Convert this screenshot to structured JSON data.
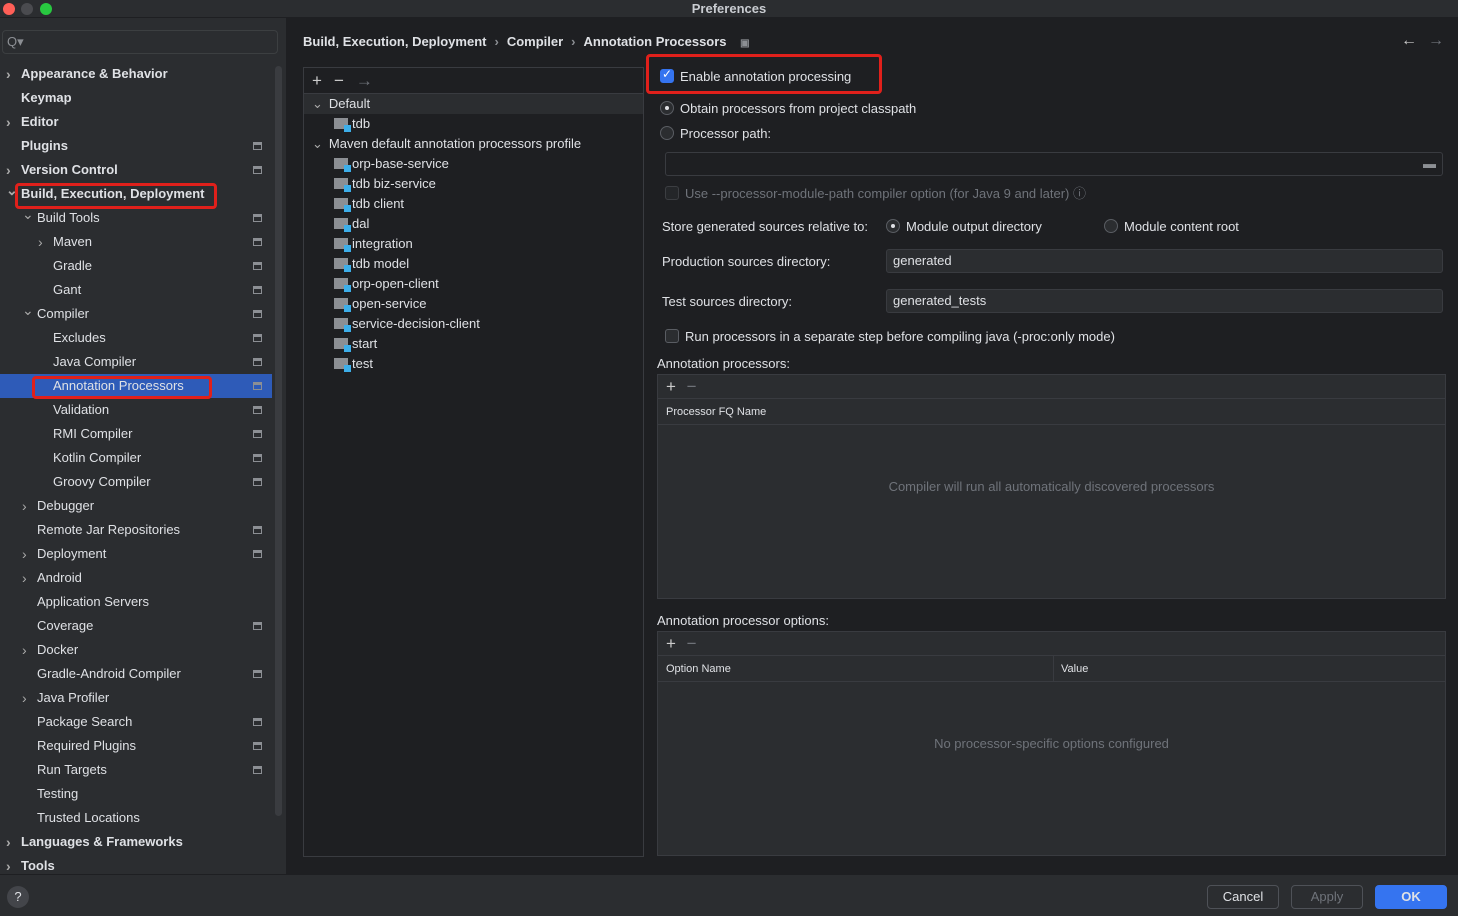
{
  "window": {
    "title": "Preferences"
  },
  "search": {
    "placeholder": "Q▾"
  },
  "sidebar": {
    "items": [
      {
        "label": "Appearance & Behavior",
        "level": 0,
        "chevron": "right",
        "bold": true,
        "settings": false
      },
      {
        "label": "Keymap",
        "level": 0,
        "chevron": "",
        "bold": true,
        "settings": false
      },
      {
        "label": "Editor",
        "level": 0,
        "chevron": "right",
        "bold": true,
        "settings": false
      },
      {
        "label": "Plugins",
        "level": 0,
        "chevron": "",
        "bold": true,
        "settings": true
      },
      {
        "label": "Version Control",
        "level": 0,
        "chevron": "right",
        "bold": true,
        "settings": true
      },
      {
        "label": "Build, Execution, Deployment",
        "level": 0,
        "chevron": "down",
        "bold": true,
        "settings": false
      },
      {
        "label": "Build Tools",
        "level": 1,
        "chevron": "down",
        "settings": true
      },
      {
        "label": "Maven",
        "level": 2,
        "chevron": "right",
        "settings": true
      },
      {
        "label": "Gradle",
        "level": 2,
        "chevron": "",
        "settings": true
      },
      {
        "label": "Gant",
        "level": 2,
        "chevron": "",
        "settings": true
      },
      {
        "label": "Compiler",
        "level": 1,
        "chevron": "down",
        "settings": true
      },
      {
        "label": "Excludes",
        "level": 2,
        "chevron": "",
        "settings": true
      },
      {
        "label": "Java Compiler",
        "level": 2,
        "chevron": "",
        "settings": true
      },
      {
        "label": "Annotation Processors",
        "level": 2,
        "chevron": "",
        "settings": true,
        "selected": true
      },
      {
        "label": "Validation",
        "level": 2,
        "chevron": "",
        "settings": true
      },
      {
        "label": "RMI Compiler",
        "level": 2,
        "chevron": "",
        "settings": true
      },
      {
        "label": "Kotlin Compiler",
        "level": 2,
        "chevron": "",
        "settings": true
      },
      {
        "label": "Groovy Compiler",
        "level": 2,
        "chevron": "",
        "settings": true
      },
      {
        "label": "Debugger",
        "level": 1,
        "chevron": "right",
        "settings": false
      },
      {
        "label": "Remote Jar Repositories",
        "level": 1,
        "chevron": "",
        "settings": true
      },
      {
        "label": "Deployment",
        "level": 1,
        "chevron": "right",
        "settings": true
      },
      {
        "label": "Android",
        "level": 1,
        "chevron": "right",
        "settings": false
      },
      {
        "label": "Application Servers",
        "level": 1,
        "chevron": "",
        "settings": false
      },
      {
        "label": "Coverage",
        "level": 1,
        "chevron": "",
        "settings": true
      },
      {
        "label": "Docker",
        "level": 1,
        "chevron": "right",
        "settings": false
      },
      {
        "label": "Gradle-Android Compiler",
        "level": 1,
        "chevron": "",
        "settings": true
      },
      {
        "label": "Java Profiler",
        "level": 1,
        "chevron": "right",
        "settings": false
      },
      {
        "label": "Package Search",
        "level": 1,
        "chevron": "",
        "settings": true
      },
      {
        "label": "Required Plugins",
        "level": 1,
        "chevron": "",
        "settings": true
      },
      {
        "label": "Run Targets",
        "level": 1,
        "chevron": "",
        "settings": true
      },
      {
        "label": "Testing",
        "level": 1,
        "chevron": "",
        "settings": false
      },
      {
        "label": "Trusted Locations",
        "level": 1,
        "chevron": "",
        "settings": false
      },
      {
        "label": "Languages & Frameworks",
        "level": 0,
        "chevron": "right",
        "bold": true,
        "settings": false
      },
      {
        "label": "Tools",
        "level": 0,
        "chevron": "right",
        "bold": true,
        "settings": false
      }
    ]
  },
  "breadcrumb": [
    "Build, Execution, Deployment",
    "Compiler",
    "Annotation Processors"
  ],
  "profiles": {
    "default": {
      "label": "Default",
      "modules": [
        "tdb"
      ]
    },
    "maven": {
      "label": "Maven default annotation processors profile",
      "modules": [
        "orp-base-service",
        "tdb biz-service",
        "tdb client",
        "dal",
        "integration",
        "tdb model",
        "orp-open-client",
        "open-service",
        "service-decision-client",
        "start",
        "test"
      ]
    }
  },
  "settings": {
    "enable": "Enable annotation processing",
    "obtain": "Obtain processors from project classpath",
    "path": "Processor path:",
    "module_path": "Use --processor-module-path compiler option (for Java 9 and later)",
    "store_label": "Store generated sources relative to:",
    "store_opt1": "Module output directory",
    "store_opt2": "Module content root",
    "prod_label": "Production sources directory:",
    "prod_value": "generated",
    "test_label": "Test sources directory:",
    "test_value": "generated_tests",
    "separate": "Run processors in a separate step before compiling java (-proc:only mode)",
    "processors_label": "Annotation processors:",
    "processors_col": "Processor FQ Name",
    "processors_empty": "Compiler will run all automatically discovered processors",
    "options_label": "Annotation processor options:",
    "options_col1": "Option Name",
    "options_col2": "Value",
    "options_empty": "No processor-specific options configured"
  },
  "buttons": {
    "cancel": "Cancel",
    "apply": "Apply",
    "ok": "OK",
    "help": "?"
  },
  "colors": {
    "accent": "#3574f0",
    "selection": "#2e5bb8",
    "highlight": "#e0201b"
  }
}
